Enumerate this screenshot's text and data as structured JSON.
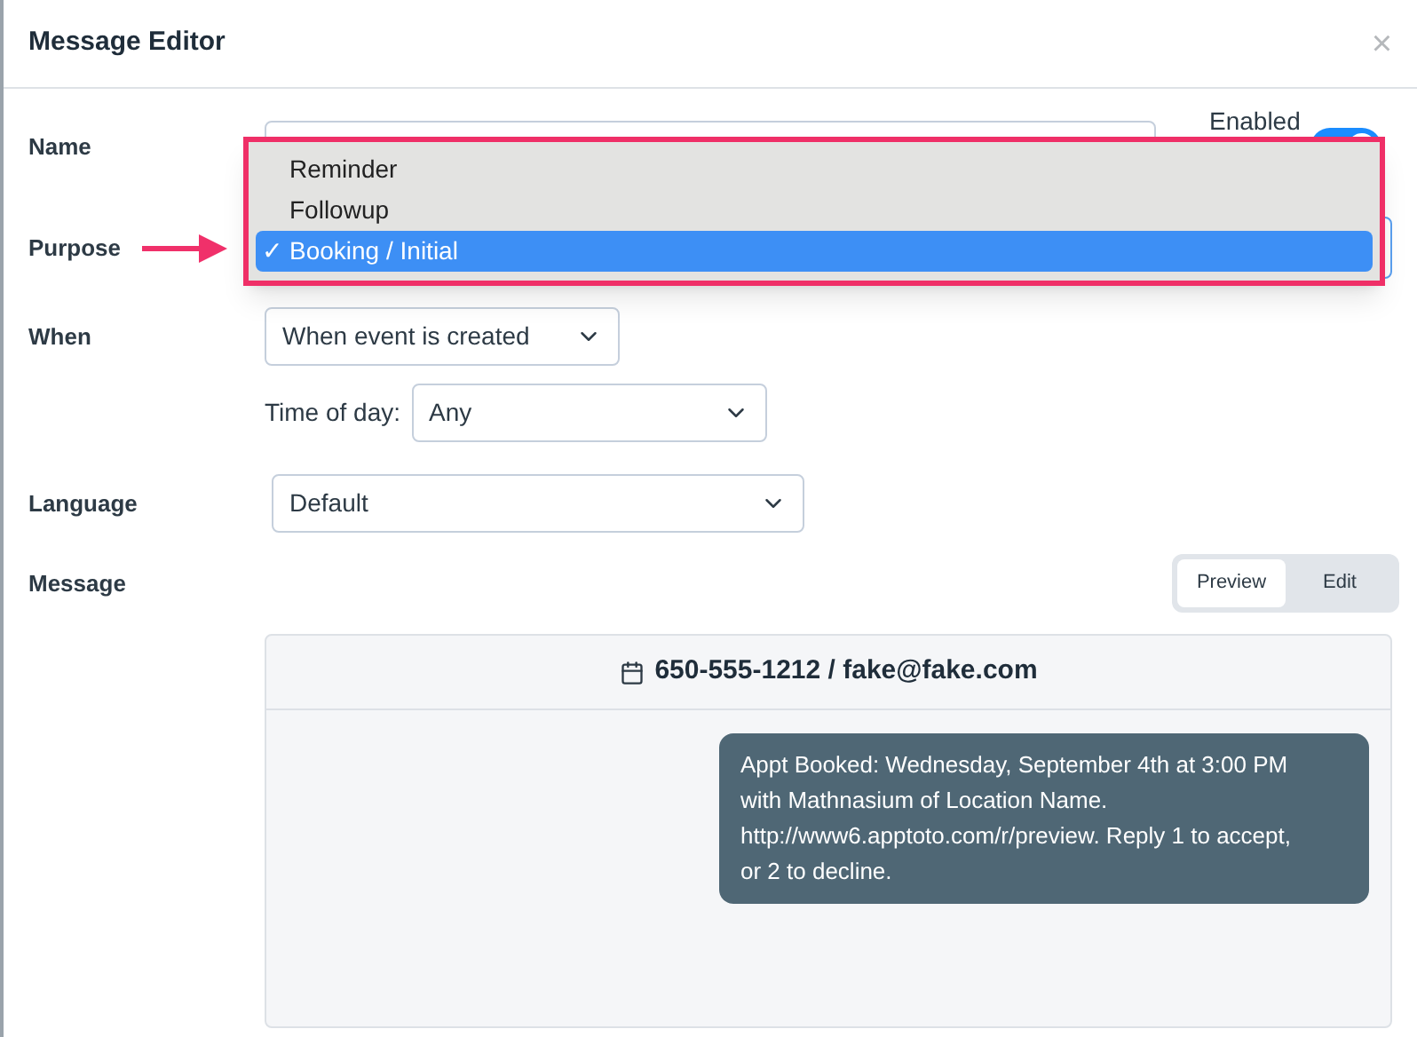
{
  "window": {
    "title": "Message Editor",
    "close": "×"
  },
  "name": {
    "label": "Name",
    "enabled_label": "Enabled",
    "enabled": true
  },
  "purpose": {
    "label": "Purpose",
    "options": [
      {
        "label": "Reminder",
        "selected": false
      },
      {
        "label": "Followup",
        "selected": false
      },
      {
        "label": "Booking / Initial",
        "selected": true
      }
    ],
    "check": "✓"
  },
  "when": {
    "label": "When",
    "value": "When event is created",
    "time_label": "Time of day:",
    "time_value": "Any"
  },
  "language": {
    "label": "Language",
    "value": "Default"
  },
  "message": {
    "label": "Message",
    "tabs": [
      {
        "label": "Preview",
        "selected": true
      },
      {
        "label": "Edit",
        "selected": false
      }
    ],
    "recipient": "650-555-1212 / fake@fake.com",
    "text": "Appt Booked: Wednesday, September 4th at 3:00 PM with Mathnasium of Location Name. http://www6.apptoto.com/r/preview. Reply 1 to accept, or 2 to decline."
  }
}
